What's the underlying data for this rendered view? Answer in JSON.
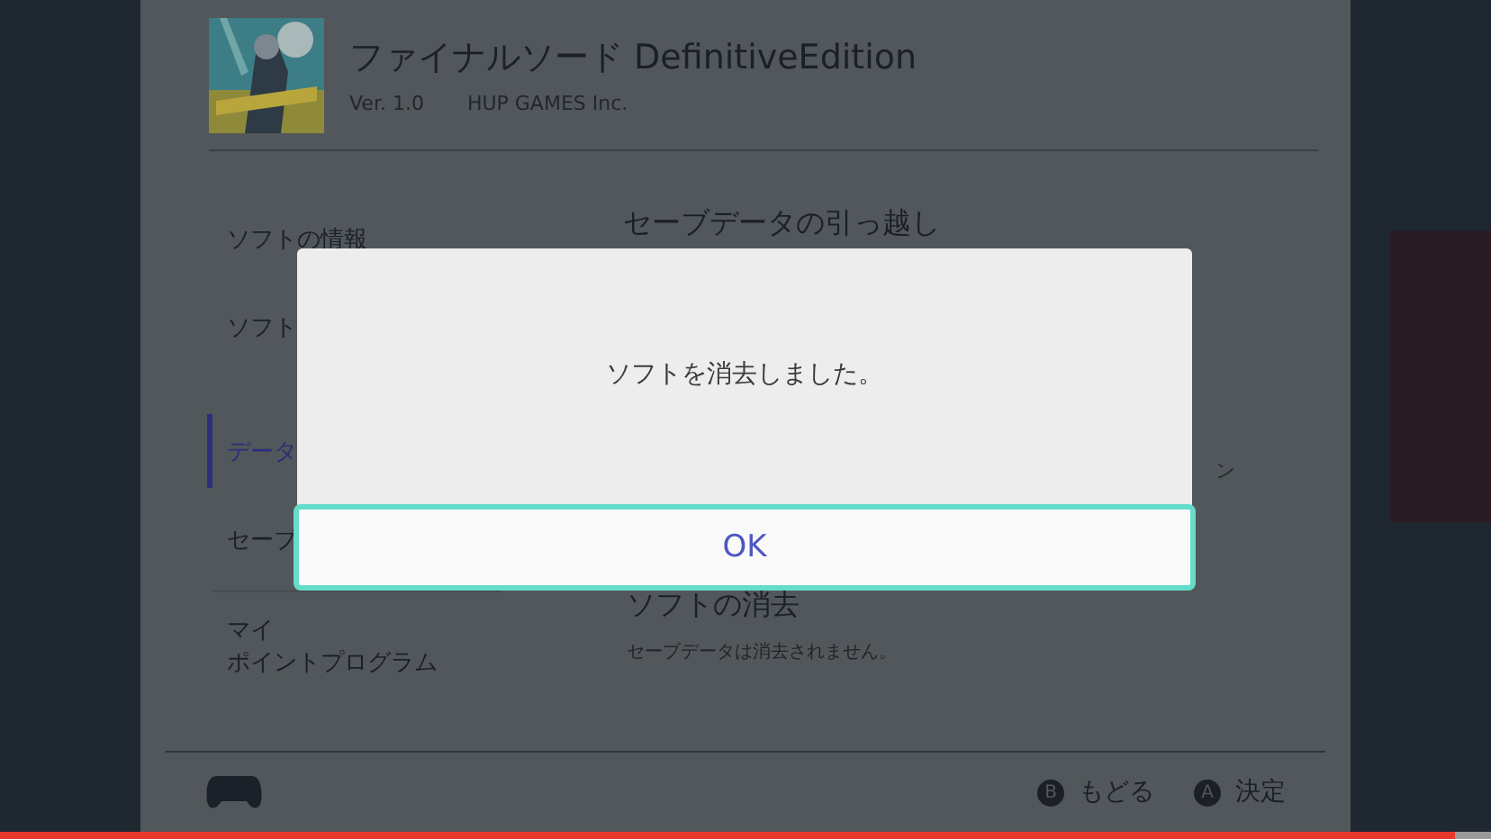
{
  "header": {
    "title": "ファイナルソード DefinitiveEdition",
    "version": "Ver. 1.0",
    "publisher": "HUP GAMES Inc."
  },
  "menu": [
    {
      "label": "ソフトの情報",
      "selected": false,
      "divider_after": false
    },
    {
      "label": "ソフト",
      "selected": false,
      "divider_after": false
    },
    {
      "label": "データ",
      "selected": true,
      "divider_after": false
    },
    {
      "label": "セーブ",
      "selected": false,
      "divider_after": true
    },
    {
      "label": "マイ",
      "label2": "ポイントプログラム",
      "selected": false,
      "divider_after": false
    }
  ],
  "content": {
    "heading": "セーブデータの引っ越し",
    "fragment": "ン",
    "heading2": "ソフトの消去",
    "note": "セーブデータは消去されません。"
  },
  "dialog": {
    "message": "ソフトを消去しました。",
    "button": "OK"
  },
  "footer": {
    "buttons": [
      {
        "key": "B",
        "label": "もどる"
      },
      {
        "key": "A",
        "label": "決定"
      }
    ]
  },
  "progress": {
    "level": 0.976
  }
}
